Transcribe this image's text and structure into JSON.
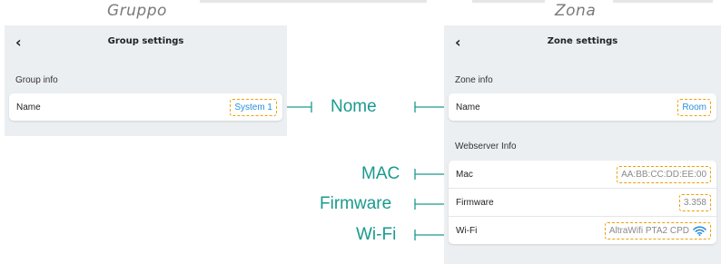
{
  "captions": {
    "group": "Gruppo",
    "zone": "Zona"
  },
  "group_panel": {
    "back_icon": "chevron-left-icon",
    "title": "Group settings",
    "section": "Group info",
    "rows": [
      {
        "label": "Name",
        "value": "System 1"
      }
    ]
  },
  "zone_panel": {
    "back_icon": "chevron-left-icon",
    "title": "Zone settings",
    "zone_section": "Zone info",
    "zone_rows": [
      {
        "label": "Name",
        "value": "Room"
      }
    ],
    "webserver_section": "Webserver Info",
    "webserver_rows": [
      {
        "label": "Mac",
        "value": "AA:BB:CC:DD:EE:00"
      },
      {
        "label": "Firmware",
        "value": "3.358"
      },
      {
        "label": "Wi-Fi",
        "value": "AltraWifi PTA2 CPD",
        "icon": "wifi-icon"
      }
    ]
  },
  "annotations": {
    "nome": "Nome",
    "mac": "MAC",
    "firmware": "Firmware",
    "wifi": "Wi-Fi"
  },
  "colors": {
    "teal": "#1a9a8e",
    "highlight": "#f0a000",
    "value_blue": "#2a8fd6",
    "panel_bg": "#eceff2"
  }
}
